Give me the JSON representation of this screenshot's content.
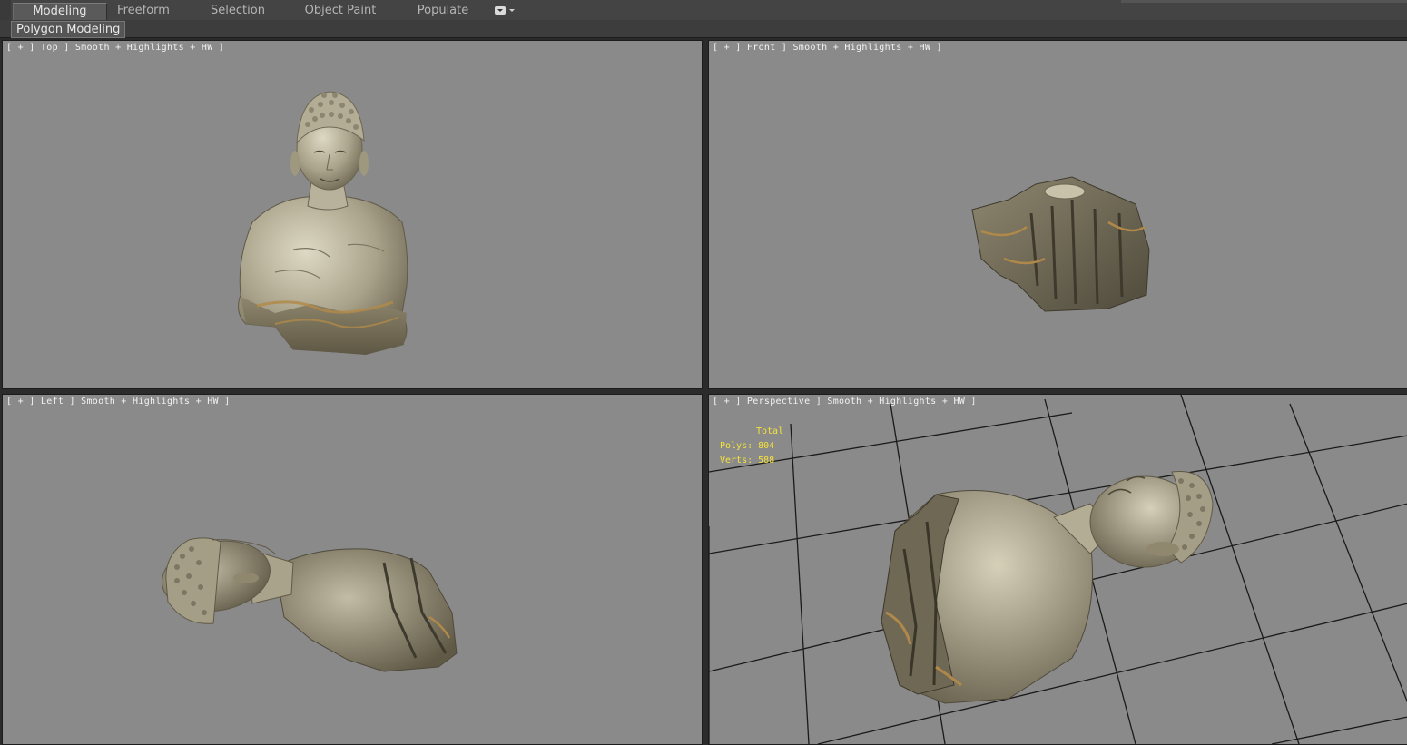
{
  "ribbon": {
    "tabs": [
      "Modeling",
      "Freeform",
      "Selection",
      "Object Paint",
      "Populate"
    ],
    "active_tab": "Modeling",
    "menu_icon": "dropdown-menu-icon"
  },
  "panel": {
    "label": "Polygon Modeling"
  },
  "viewports": {
    "top": {
      "label": "[ + ] Top ] Smooth + Highlights + HW ]"
    },
    "front": {
      "label": "[ + ] Front ] Smooth + Highlights + HW ]"
    },
    "left": {
      "label": "[ + ] Left ] Smooth + Highlights + HW ]"
    },
    "perspective": {
      "label": "[ + ] Perspective ] Smooth + Highlights + HW ]",
      "stats": {
        "header": "Total",
        "polys": "Polys: 804",
        "verts": "Verts: 588"
      }
    }
  },
  "colors": {
    "viewport_bg": "#8a8a8a",
    "stats_text": "#f5e33a",
    "stone": "#b8b29c",
    "stone_dark": "#6b6450",
    "crack": "#b0894a"
  }
}
